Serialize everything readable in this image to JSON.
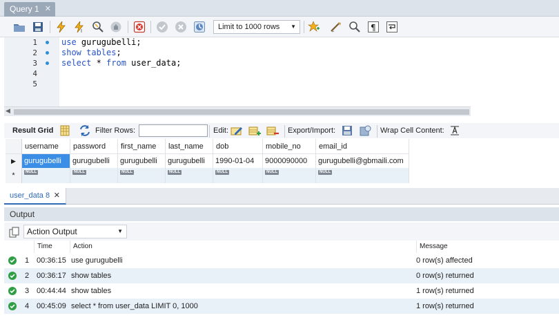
{
  "query_tab": {
    "title": "Query 1",
    "close": "✕"
  },
  "toolbar": {
    "limit_select": "Limit to 1000 rows",
    "icons": [
      "open-icon",
      "save-icon",
      "execute-icon",
      "execute-current-icon",
      "explain-icon",
      "stop-icon",
      "toggle-error-icon",
      "commit-icon",
      "rollback-icon",
      "autocommit-icon",
      "add-snippet-icon",
      "beautify-icon",
      "find-icon",
      "invisible-chars-icon",
      "wrap-icon"
    ]
  },
  "editor": {
    "line_numbers": [
      "1",
      "2",
      "3",
      "4",
      "5"
    ],
    "lines": [
      {
        "kw": "use",
        "rest": " gurugubelli;"
      },
      {
        "kw": "show tables",
        "rest": ";"
      },
      {
        "kw": "select",
        "mid": " * ",
        "kw2": "from",
        "rest": " user_data;"
      }
    ]
  },
  "result_toolbar": {
    "result_grid": "Result Grid",
    "filter_rows": "Filter Rows:",
    "edit": "Edit:",
    "export_import": "Export/Import:",
    "wrap_cell": "Wrap Cell Content:"
  },
  "grid": {
    "columns": [
      "username",
      "password",
      "first_name",
      "last_name",
      "dob",
      "mobile_no",
      "email_id"
    ],
    "rows": [
      [
        "gurugubelli",
        "gurugubelli",
        "gurugubelli",
        "gurugubelli",
        "1990-01-04",
        "9000090000",
        "gurugubelli@gbmaili.com"
      ]
    ],
    "null_label": "NULL",
    "new_row_marker": "*",
    "current_row_marker": "▶"
  },
  "result_tab": {
    "label": "user_data 8",
    "close": "✕"
  },
  "output": {
    "header": "Output",
    "action_select": "Action Output",
    "columns": {
      "time": "Time",
      "action": "Action",
      "message": "Message"
    },
    "rows": [
      {
        "n": "1",
        "time": "00:36:15",
        "action": "use gurugubelli",
        "message": "0 row(s) affected"
      },
      {
        "n": "2",
        "time": "00:36:17",
        "action": "show tables",
        "message": "0 row(s) returned"
      },
      {
        "n": "3",
        "time": "00:44:44",
        "action": "show tables",
        "message": "1 row(s) returned"
      },
      {
        "n": "4",
        "time": "00:45:09",
        "action": "select * from user_data LIMIT 0, 1000",
        "message": "1 row(s) returned"
      }
    ]
  },
  "colors": {
    "accent": "#2f6ab3",
    "ok": "#2f9e44",
    "selected_cell": "#3a8ee6"
  }
}
